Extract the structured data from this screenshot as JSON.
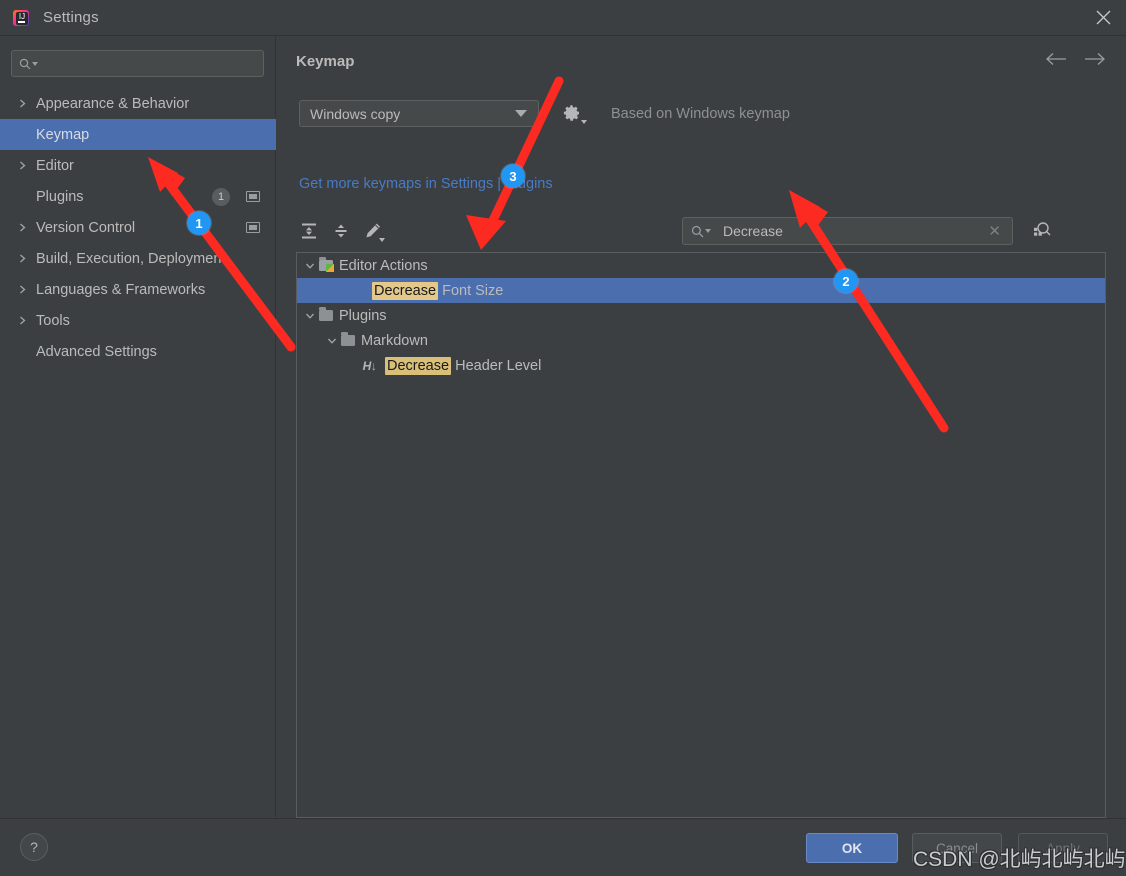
{
  "window": {
    "title": "Settings",
    "app_icon": "intellij-idea-icon",
    "close_label": "✕"
  },
  "sidebar": {
    "search": {
      "value": "",
      "placeholder": ""
    },
    "items": [
      {
        "label": "Appearance & Behavior",
        "expandable": true,
        "selected": false,
        "indent": 0
      },
      {
        "label": "Keymap",
        "expandable": false,
        "selected": true,
        "indent": 1
      },
      {
        "label": "Editor",
        "expandable": true,
        "selected": false,
        "indent": 0
      },
      {
        "label": "Plugins",
        "expandable": false,
        "selected": false,
        "indent": 1,
        "badge": "1",
        "panel_icon": true
      },
      {
        "label": "Version Control",
        "expandable": true,
        "selected": false,
        "indent": 0,
        "panel_icon": true
      },
      {
        "label": "Build, Execution, Deployment",
        "expandable": true,
        "selected": false,
        "indent": 0
      },
      {
        "label": "Languages & Frameworks",
        "expandable": true,
        "selected": false,
        "indent": 0
      },
      {
        "label": "Tools",
        "expandable": true,
        "selected": false,
        "indent": 0
      },
      {
        "label": "Advanced Settings",
        "expandable": false,
        "selected": false,
        "indent": 1
      }
    ]
  },
  "main": {
    "title": "Keymap",
    "nav": {
      "back": "←",
      "forward": "→"
    },
    "keymap_select": {
      "value": "Windows copy"
    },
    "gear_icon": "gear-icon",
    "based_on": "Based on Windows keymap",
    "link": "Get more keymaps in Settings | Plugins",
    "toolbar": {
      "expand_all": "expand-all-icon",
      "collapse_all": "collapse-all-icon",
      "edit_shortcut": "edit-pencil-icon"
    },
    "find": {
      "value": "Decrease",
      "clear_label": "✕",
      "shortcut_find_icon": "find-by-shortcut-icon"
    },
    "tree": [
      {
        "label": "Editor Actions",
        "icon": "editor-actions-folder-icon",
        "indent": 0,
        "expandable": true,
        "expanded": true,
        "selected": false,
        "highlight": ""
      },
      {
        "label": "Decrease Font Size",
        "icon": "",
        "indent": 2,
        "expandable": false,
        "expanded": false,
        "selected": true,
        "highlight": "Decrease",
        "rest": " Font Size"
      },
      {
        "label": "Plugins",
        "icon": "folder-icon",
        "indent": 0,
        "expandable": true,
        "expanded": true,
        "selected": false,
        "highlight": ""
      },
      {
        "label": "Markdown",
        "icon": "folder-icon",
        "indent": 1,
        "expandable": true,
        "expanded": true,
        "selected": false,
        "highlight": ""
      },
      {
        "label": "Decrease Header Level",
        "icon": "header-decrease-icon",
        "indent": 2,
        "expandable": false,
        "expanded": false,
        "selected": false,
        "highlight": "Decrease",
        "rest": " Header Level"
      }
    ]
  },
  "footer": {
    "help_label": "?",
    "ok_label": "OK",
    "cancel_label": "Cancel",
    "apply_label": "Apply"
  },
  "annotations": {
    "badges": [
      {
        "text": "1"
      },
      {
        "text": "2"
      },
      {
        "text": "3"
      }
    ],
    "arrow_color": "#fc2a21",
    "badge_color": "#2196f3"
  },
  "watermark": {
    "text": "CSDN @北屿北屿北屿"
  }
}
